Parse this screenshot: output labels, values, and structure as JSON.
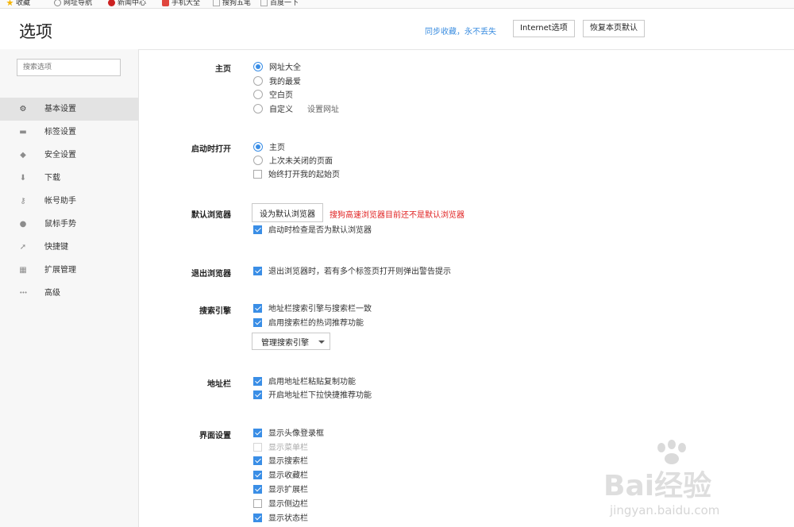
{
  "bookmarks": [
    {
      "label": "收藏",
      "color": "#f5b400"
    },
    {
      "label": "网址导航",
      "color": "#888888"
    },
    {
      "label": "新闻中心",
      "color": "#cc2222"
    },
    {
      "label": "手机大全",
      "color": "#e0463e"
    },
    {
      "label": "搜狗五笔",
      "color": "#cccccc"
    },
    {
      "label": "百度一下",
      "color": "#cccccc"
    }
  ],
  "header": {
    "title": "选项",
    "sync_text": "同步收藏，永不丢失",
    "internet_options": "Internet选项",
    "restore_default": "恢复本页默认"
  },
  "sidebar": {
    "search_placeholder": "搜索选项",
    "items": [
      {
        "label": "基本设置",
        "icon": "gear-icon",
        "glyph": "⚙",
        "active": true
      },
      {
        "label": "标签设置",
        "icon": "tab-icon",
        "glyph": "▬",
        "active": false
      },
      {
        "label": "安全设置",
        "icon": "shield-icon",
        "glyph": "◆",
        "active": false
      },
      {
        "label": "下载",
        "icon": "download-icon",
        "glyph": "⬇",
        "active": false
      },
      {
        "label": "帐号助手",
        "icon": "key-icon",
        "glyph": "⚷",
        "active": false
      },
      {
        "label": "鼠标手势",
        "icon": "mouse-icon",
        "glyph": "●",
        "active": false
      },
      {
        "label": "快捷键",
        "icon": "shortcut-icon",
        "glyph": "➚",
        "active": false
      },
      {
        "label": "扩展管理",
        "icon": "extensions-icon",
        "glyph": "▦",
        "active": false
      },
      {
        "label": "高级",
        "icon": "more-icon",
        "glyph": "•••",
        "active": false
      }
    ]
  },
  "sections": {
    "homepage": {
      "label": "主页",
      "options": [
        "网址大全",
        "我的最爱",
        "空白页",
        "自定义"
      ],
      "selected": 0,
      "set_url_link": "设置网址"
    },
    "startup": {
      "label": "启动时打开",
      "options": [
        "主页",
        "上次未关闭的页面"
      ],
      "selected": 0,
      "always_open_start": {
        "label": "始终打开我的起始页",
        "checked": false
      }
    },
    "default_browser": {
      "label": "默认浏览器",
      "button": "设为默认浏览器",
      "warning": "搜狗高速浏览器目前还不是默认浏览器",
      "check_on_start": {
        "label": "启动时检查是否为默认浏览器",
        "checked": true
      }
    },
    "exit_browser": {
      "label": "退出浏览器",
      "warn_multi_tabs": {
        "label": "退出浏览器时，若有多个标签页打开则弹出警告提示",
        "checked": true
      }
    },
    "search_engine": {
      "label": "搜索引擎",
      "options": [
        {
          "label": "地址栏搜索引擎与搜索栏一致",
          "checked": true
        },
        {
          "label": "启用搜索栏的热词推荐功能",
          "checked": true
        }
      ],
      "manage_button": "管理搜索引擎"
    },
    "address_bar": {
      "label": "地址栏",
      "options": [
        {
          "label": "启用地址栏粘贴复制功能",
          "checked": true
        },
        {
          "label": "开启地址栏下拉快捷推荐功能",
          "checked": true
        }
      ]
    },
    "interface": {
      "label": "界面设置",
      "options": [
        {
          "label": "显示头像登录框",
          "checked": true,
          "disabled": false
        },
        {
          "label": "显示菜单栏",
          "checked": false,
          "disabled": true
        },
        {
          "label": "显示搜索栏",
          "checked": true,
          "disabled": false
        },
        {
          "label": "显示收藏栏",
          "checked": true,
          "disabled": false
        },
        {
          "label": "显示扩展栏",
          "checked": true,
          "disabled": false
        },
        {
          "label": "显示侧边栏",
          "checked": false,
          "disabled": false
        },
        {
          "label": "显示状态栏",
          "checked": true,
          "disabled": false
        }
      ]
    }
  },
  "watermark": {
    "brand": "Bai经验",
    "url": "jingyan.baidu.com"
  }
}
